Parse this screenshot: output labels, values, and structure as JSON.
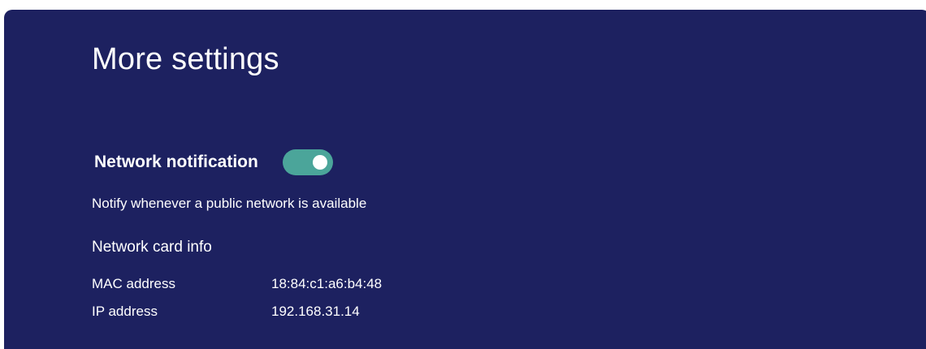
{
  "page": {
    "title": "More settings"
  },
  "network_notification": {
    "label": "Network notification",
    "enabled": true,
    "description": "Notify whenever a public network is available"
  },
  "network_card_info": {
    "heading": "Network card info",
    "rows": [
      {
        "key": "MAC address",
        "value": "18:84:c1:a6:b4:48"
      },
      {
        "key": "IP address",
        "value": "192.168.31.14"
      }
    ]
  },
  "colors": {
    "panel_background": "#1d2160",
    "toggle_on": "#4ba59a",
    "text": "#ffffff"
  }
}
